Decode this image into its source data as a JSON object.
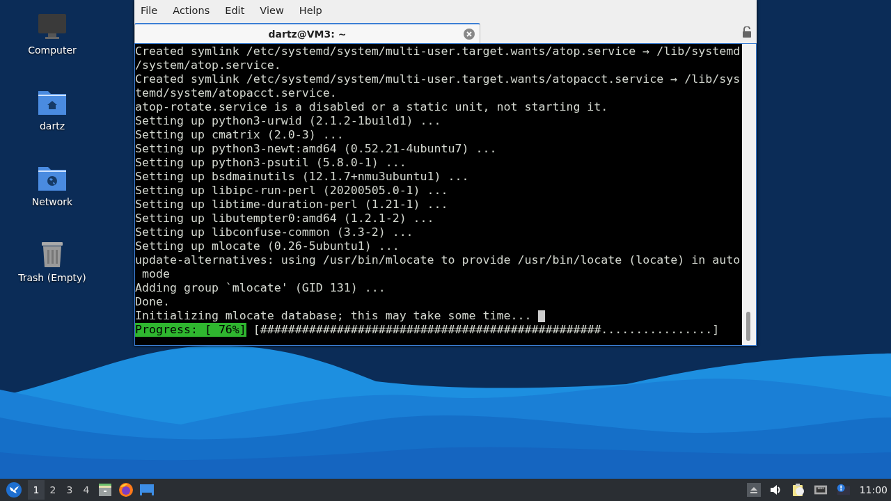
{
  "desktop_icons": [
    {
      "label": "Computer",
      "kind": "computer"
    },
    {
      "label": "dartz",
      "kind": "home"
    },
    {
      "label": "Network",
      "kind": "network"
    },
    {
      "label": "Trash (Empty)",
      "kind": "trash"
    }
  ],
  "window": {
    "menu": [
      "File",
      "Actions",
      "Edit",
      "View",
      "Help"
    ],
    "tabs": [
      {
        "title": "dartz@VM3: ~",
        "selected": true
      }
    ],
    "terminal": {
      "lines": [
        "Created symlink /etc/systemd/system/multi-user.target.wants/atop.service → /lib/systemd",
        "/system/atop.service.",
        "Created symlink /etc/systemd/system/multi-user.target.wants/atopacct.service → /lib/sys",
        "temd/system/atopacct.service.",
        "atop-rotate.service is a disabled or a static unit, not starting it.",
        "Setting up python3-urwid (2.1.2-1build1) ...",
        "Setting up cmatrix (2.0-3) ...",
        "Setting up python3-newt:amd64 (0.52.21-4ubuntu7) ...",
        "Setting up python3-psutil (5.8.0-1) ...",
        "Setting up bsdmainutils (12.1.7+nmu3ubuntu1) ...",
        "Setting up libipc-run-perl (20200505.0-1) ...",
        "Setting up libtime-duration-perl (1.21-1) ...",
        "Setting up libutempter0:amd64 (1.2.1-2) ...",
        "Setting up libconfuse-common (3.3-2) ...",
        "Setting up mlocate (0.26-5ubuntu1) ...",
        "update-alternatives: using /usr/bin/mlocate to provide /usr/bin/locate (locate) in auto",
        " mode",
        "Adding group `mlocate' (GID 131) ...",
        "Done.",
        "Initializing mlocate database; this may take some time... "
      ],
      "progress": {
        "label": "Progress: [ 76%]",
        "bar": "[#################################################................]"
      }
    }
  },
  "taskbar": {
    "workspaces": [
      {
        "label": "1",
        "selected": true
      },
      {
        "label": "2",
        "selected": false
      },
      {
        "label": "3",
        "selected": false
      },
      {
        "label": "4",
        "selected": false
      }
    ],
    "clock": "11:00"
  }
}
